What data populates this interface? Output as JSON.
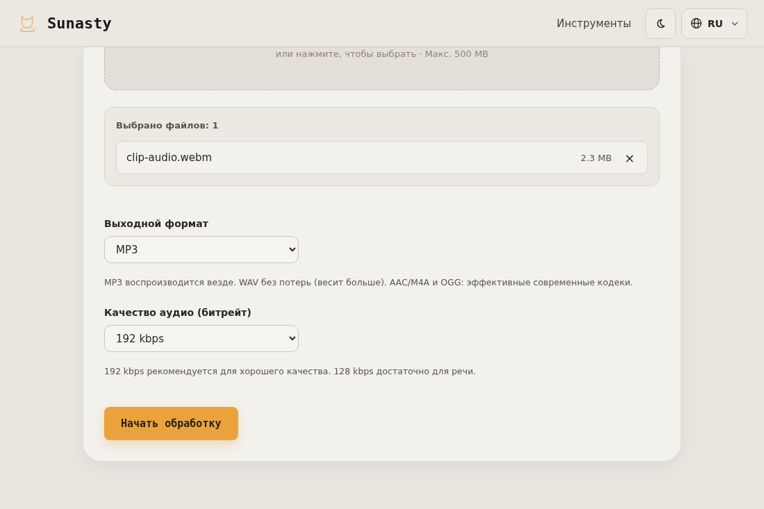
{
  "header": {
    "brand": "Sunasty",
    "nav_link": "Инструменты",
    "language": "RU"
  },
  "dropzone": {
    "hint": "или нажмите, чтобы выбрать · Макс. 500 MB"
  },
  "selected_files": {
    "title": "Выбрано файлов: 1",
    "files": [
      {
        "name": "clip-audio.webm",
        "size": "2.3 MB",
        "remove": "×"
      }
    ]
  },
  "fields": [
    {
      "label": "Выходной формат",
      "value": "MP3",
      "help": "MP3 воспроизводится везде. WAV без потерь (весит больше). AAC/M4A и OGG: эффективные современные кодеки."
    },
    {
      "label": "Качество аудио (битрейт)",
      "value": "192 kbps",
      "help": "192 kbps рекомендуется для хорошего качества. 128 kbps достаточно для речи."
    }
  ],
  "start_button": "Начать обработку"
}
